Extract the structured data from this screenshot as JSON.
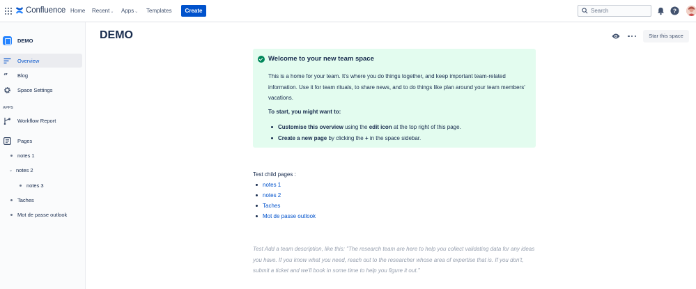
{
  "topnav": {
    "app_name": "Confluence",
    "items": [
      {
        "label": "Home"
      },
      {
        "label": "Recent"
      },
      {
        "label": "Apps"
      },
      {
        "label": "Templates"
      }
    ],
    "create_label": "Create",
    "search_placeholder": "Search",
    "icons": [
      "app-switcher-icon",
      "notification-icon",
      "help-icon",
      "avatar"
    ],
    "brand_color": "#0052cc"
  },
  "sidebar": {
    "space_name": "DEMO",
    "nav": [
      {
        "label": "Overview",
        "icon": "overview-icon",
        "active": true
      },
      {
        "label": "Blog",
        "icon": "quote-icon"
      },
      {
        "label": "Space Settings",
        "icon": "gear-icon"
      }
    ],
    "apps_label": "APPS",
    "apps": [
      {
        "label": "Workflow Report",
        "icon": "workflow-icon"
      }
    ],
    "pages_label": "Pages",
    "tree": [
      {
        "label": "notes 1",
        "level": 0
      },
      {
        "label": "notes 2",
        "level": 0,
        "expanded": true
      },
      {
        "label": "notes 3",
        "level": 1
      },
      {
        "label": "Taches",
        "level": 0
      },
      {
        "label": "Mot de passe outlook",
        "level": 0
      }
    ]
  },
  "main": {
    "title": "DEMO",
    "star_label": "Star this space",
    "panel": {
      "title": "Welcome to your new team space",
      "body": "This is a home for your team. It's where you do things together, and keep important team-related information. Use it for team rituals, to share news, and to do things like plan around your team members' vacations.",
      "subheading": "To start, you might want to:",
      "items": [
        {
          "bold": "Customise this overview",
          "t1": " using the ",
          "bold2": "edit icon",
          "t2": " at the top right of this page."
        },
        {
          "bold": "Create a new page",
          "t1": " by clicking the ",
          "bold2": "+",
          "t2": " in the space sidebar."
        }
      ],
      "color": "#e3fcef"
    },
    "children_label": "Test child pages :",
    "children": [
      "notes 1",
      "notes 2",
      "Taches",
      "Mot de passe outlook"
    ],
    "description": "Test Add a team description, like this: \"The research team are here to help you collect validating data for any ideas you have. If you know what you need, reach out to the researcher whose area of expertise that is. If you don't, submit a ticket and we'll book in some time to help you figure it out.\""
  }
}
